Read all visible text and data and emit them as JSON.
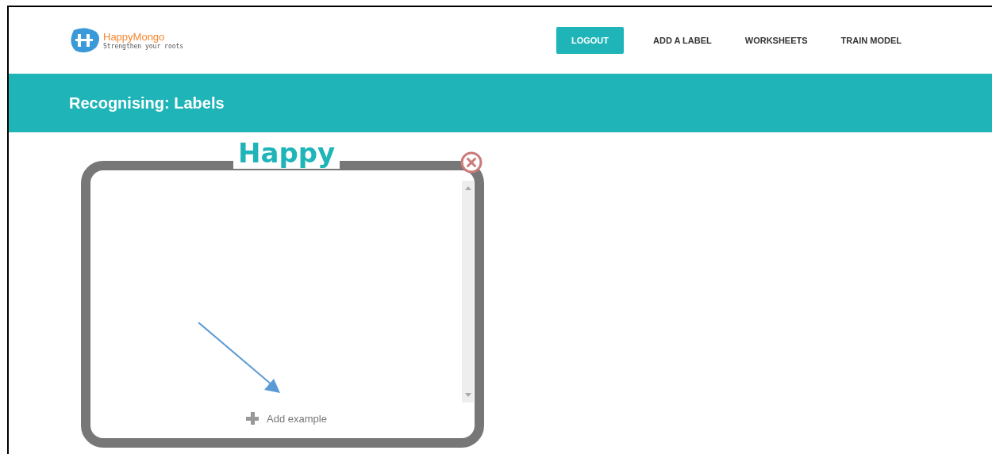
{
  "brand": {
    "name": "HappyMongo",
    "tagline": "Strengthen your roots"
  },
  "nav": [
    {
      "label": "LOGOUT",
      "selected": true
    },
    {
      "label": "ADD A LABEL",
      "selected": false
    },
    {
      "label": "WORKSHEETS",
      "selected": false
    },
    {
      "label": "TRAIN MODEL",
      "selected": false
    }
  ],
  "banner": {
    "title": "Recognising: Labels"
  },
  "label_card": {
    "title": "Happy",
    "add_button": "Add example"
  }
}
